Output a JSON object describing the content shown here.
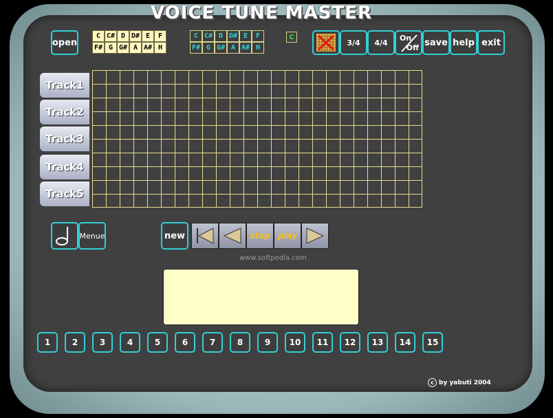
{
  "app": {
    "title": "VOICE TUNE MASTER"
  },
  "toolbar": {
    "open_label": "open",
    "notes_row1": [
      "C",
      "C#",
      "D",
      "D#",
      "E",
      "F"
    ],
    "notes_row2": [
      "F#",
      "G",
      "G#",
      "A",
      "A#",
      "H"
    ],
    "key_badge": "C",
    "time_34": "3/4",
    "time_44": "4/4",
    "on_label": "On",
    "off_label": "Off",
    "save_label": "save",
    "help_label": "help",
    "exit_label": "exit"
  },
  "tracks": [
    "Track1",
    "Track2",
    "Track3",
    "Track4",
    "Track5"
  ],
  "controls": {
    "menu_label": "Menue",
    "new_label": "new",
    "stop_label": "stop",
    "play_label": "play"
  },
  "watermark": "www.softpedia.com",
  "numbers": [
    "1",
    "2",
    "3",
    "4",
    "5",
    "6",
    "7",
    "8",
    "9",
    "10",
    "11",
    "12",
    "13",
    "14",
    "15"
  ],
  "credit": {
    "symbol": "c",
    "text": "by yabuti 2004"
  },
  "colors": {
    "accent": "#33d0d6",
    "grid": "#e7dd8f",
    "display": "#ffffc8",
    "transport_text": "#f3c21a"
  }
}
